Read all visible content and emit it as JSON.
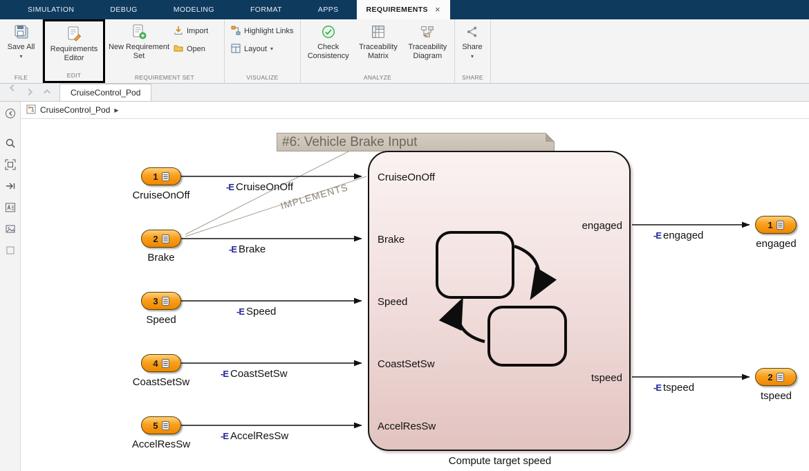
{
  "colors": {
    "titlebar": "#0e3a5e",
    "port_orange": "#f9a01e",
    "chart_pink": "#e2c3c0",
    "annotation_bg": "#ccc4b7",
    "log_badge_blue": "#26269b",
    "check_green": "#3fae49"
  },
  "icons": {
    "close": "×",
    "dropdown": "▾",
    "breadcrumb_arrow": "▶"
  },
  "menubar": {
    "tabs": [
      {
        "label": "SIMULATION"
      },
      {
        "label": "DEBUG"
      },
      {
        "label": "MODELING"
      },
      {
        "label": "FORMAT"
      },
      {
        "label": "APPS"
      },
      {
        "label": "REQUIREMENTS"
      }
    ]
  },
  "toolbar": {
    "file": {
      "section_label": "FILE",
      "save_all": "Save All"
    },
    "edit": {
      "section_label": "EDIT",
      "requirements_editor": "Requirements Editor"
    },
    "req_set": {
      "section_label": "REQUIREMENT SET",
      "new_requirement_set": "New Requirement Set",
      "import": "Import",
      "open": "Open"
    },
    "visualize": {
      "section_label": "VISUALIZE",
      "highlight_links": "Highlight Links",
      "layout": "Layout"
    },
    "analyze": {
      "section_label": "ANALYZE",
      "check_consistency": "Check Consistency",
      "traceability_matrix": "Traceability Matrix",
      "traceability_diagram": "Traceability Diagram"
    },
    "share": {
      "section_label": "SHARE",
      "share": "Share"
    }
  },
  "docbar": {
    "tab": "CruiseControl_Pod"
  },
  "breadcrumb": {
    "model": "CruiseControl_Pod"
  },
  "model": {
    "annotation": "#6: Vehicle Brake Input",
    "implements": "IMPLEMENTS",
    "chart_name": "Compute target speed",
    "log_badge": "-E",
    "chart_inputs": [
      "CruiseOnOff",
      "Brake",
      "Speed",
      "CoastSetSw",
      "AccelResSw"
    ],
    "chart_outputs": [
      "engaged",
      "tspeed"
    ],
    "inports": [
      {
        "number": "1",
        "name": "CruiseOnOff",
        "signal": "CruiseOnOff"
      },
      {
        "number": "2",
        "name": "Brake",
        "signal": "Brake"
      },
      {
        "number": "3",
        "name": "Speed",
        "signal": "Speed"
      },
      {
        "number": "4",
        "name": "CoastSetSw",
        "signal": "CoastSetSw"
      },
      {
        "number": "5",
        "name": "AccelResSw",
        "signal": "AccelResSw"
      }
    ],
    "outports": [
      {
        "number": "1",
        "name": "engaged",
        "signal": "engaged"
      },
      {
        "number": "2",
        "name": "tspeed",
        "signal": "tspeed"
      }
    ]
  }
}
